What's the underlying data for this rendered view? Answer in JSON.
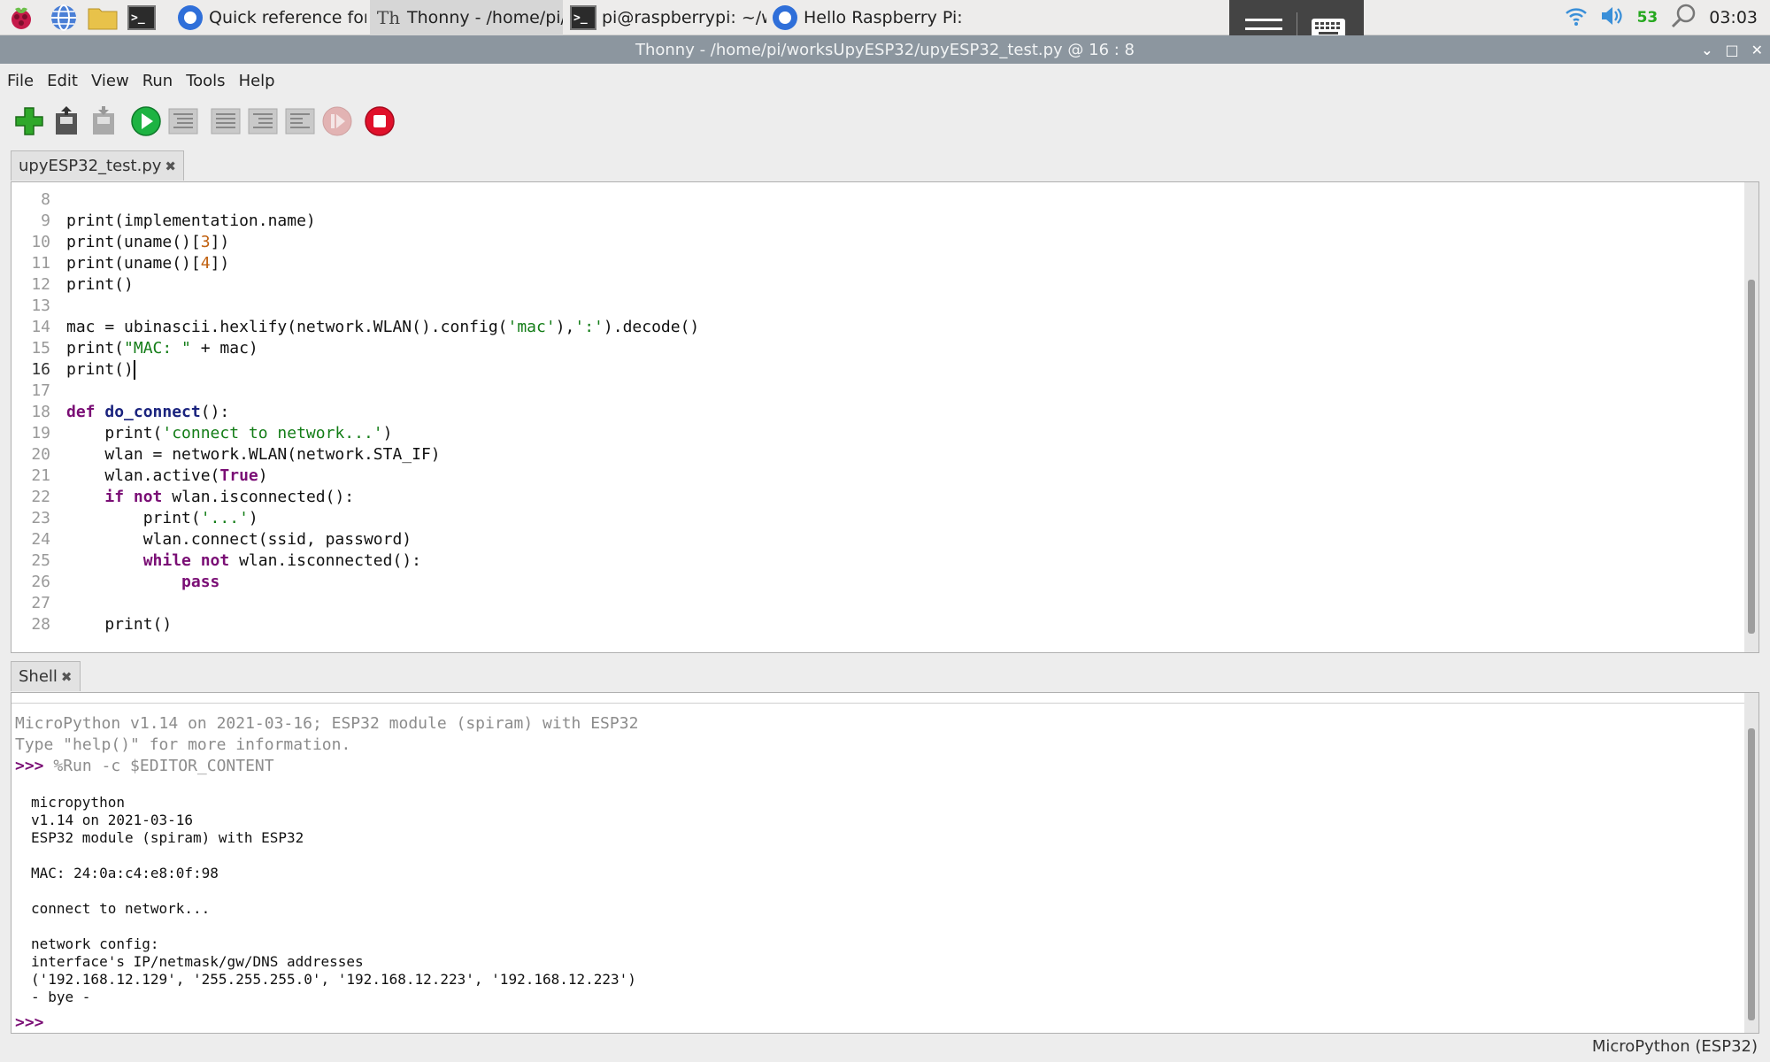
{
  "taskbar": {
    "launchers": [
      {
        "name": "raspberry-menu-icon"
      },
      {
        "name": "web-browser-icon"
      },
      {
        "name": "file-manager-icon"
      },
      {
        "name": "terminal-icon"
      }
    ],
    "tasks": [
      {
        "label": "Quick reference for th...",
        "icon": "chromium-icon"
      },
      {
        "label": "Thonny  -  /home/pi/...",
        "icon": "thonny-icon",
        "active": true
      },
      {
        "label": "pi@raspberrypi: ~/wo...",
        "icon": "terminal-icon"
      },
      {
        "label": "Hello Raspberry Pi: S...",
        "icon": "chromium-icon"
      }
    ],
    "battery": "53",
    "clock": "03:03"
  },
  "window": {
    "title": "Thonny  -  /home/pi/worksUpyESP32/upyESP32_test.py  @  16 : 8"
  },
  "menu": [
    "File",
    "Edit",
    "View",
    "Run",
    "Tools",
    "Help"
  ],
  "toolbar": [
    "new-file",
    "load-file",
    "save-file",
    "run",
    "debug",
    "step-over",
    "step-into",
    "step-out",
    "resume",
    "stop"
  ],
  "editor": {
    "tab_label": "upyESP32_test.py",
    "line_numbers": [
      "8",
      "9",
      "10",
      "11",
      "12",
      "13",
      "14",
      "15",
      "16",
      "17",
      "18",
      "19",
      "20",
      "21",
      "22",
      "23",
      "24",
      "25",
      "26",
      "27",
      "28"
    ],
    "current_line": "16"
  },
  "shell": {
    "tab_label": "Shell",
    "banner_1": "MicroPython v1.14 on 2021-03-16; ESP32 module (spiram) with ESP32",
    "banner_2": "Type \"help()\" for more information.",
    "prompt": ">>>",
    "run_command": "%Run -c $EDITOR_CONTENT",
    "output": [
      "micropython",
      "v1.14 on 2021-03-16",
      "ESP32 module (spiram) with ESP32",
      "",
      "MAC: 24:0a:c4:e8:0f:98",
      "",
      "connect to network...",
      "",
      "network config:",
      "interface's IP/netmask/gw/DNS addresses",
      "('192.168.12.129', '255.255.255.0', '192.168.12.223', '192.168.12.223')",
      "- bye -"
    ]
  },
  "status": {
    "interpreter": "MicroPython (ESP32)"
  }
}
